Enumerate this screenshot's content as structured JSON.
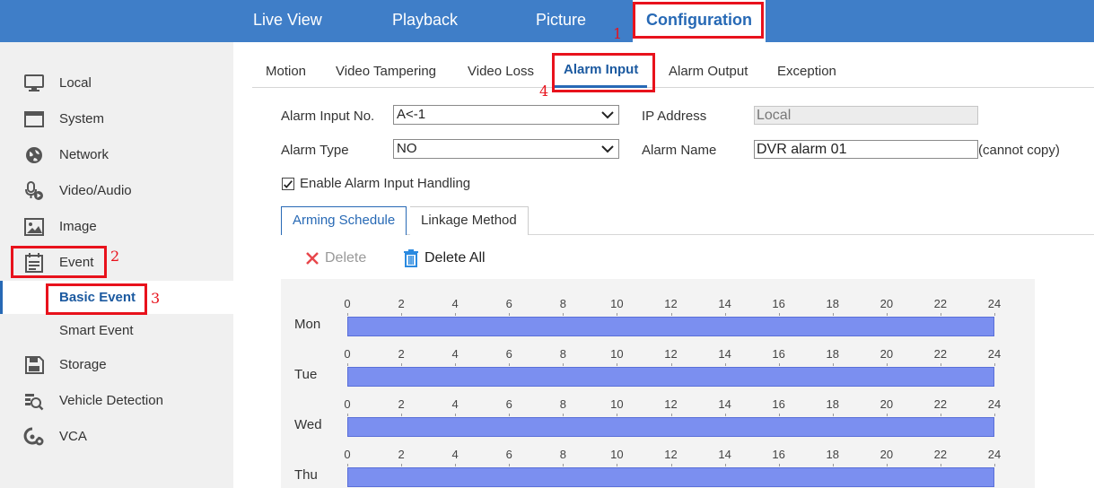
{
  "topnav": {
    "items": [
      {
        "label": "Live View"
      },
      {
        "label": "Playback"
      },
      {
        "label": "Picture"
      },
      {
        "label": "Configuration"
      }
    ]
  },
  "sidebar": {
    "items": [
      {
        "label": "Local",
        "icon": "monitor-icon"
      },
      {
        "label": "System",
        "icon": "window-icon"
      },
      {
        "label": "Network",
        "icon": "globe-icon"
      },
      {
        "label": "Video/Audio",
        "icon": "microphone-icon"
      },
      {
        "label": "Image",
        "icon": "image-icon"
      },
      {
        "label": "Event",
        "icon": "calendar-icon"
      },
      {
        "label": "Storage",
        "icon": "floppy-disk-icon"
      },
      {
        "label": "Vehicle Detection",
        "icon": "vehicle-search-icon"
      },
      {
        "label": "VCA",
        "icon": "vca-icon"
      }
    ],
    "event_sub": [
      {
        "label": "Basic Event"
      },
      {
        "label": "Smart Event"
      }
    ]
  },
  "subtabs": [
    {
      "label": "Motion"
    },
    {
      "label": "Video Tampering"
    },
    {
      "label": "Video Loss"
    },
    {
      "label": "Alarm Input"
    },
    {
      "label": "Alarm Output"
    },
    {
      "label": "Exception"
    }
  ],
  "form": {
    "alarm_input_no_label": "Alarm Input No.",
    "alarm_input_no_value": "A<-1",
    "alarm_type_label": "Alarm Type",
    "alarm_type_value": "NO",
    "ip_address_label": "IP Address",
    "ip_address_value": "Local",
    "alarm_name_label": "Alarm Name",
    "alarm_name_value": "DVR alarm 01",
    "alarm_name_note": "(cannot copy)",
    "enable_label": "Enable Alarm Input Handling",
    "enable_checked": true
  },
  "schedule": {
    "tabs": [
      {
        "label": "Arming Schedule"
      },
      {
        "label": "Linkage Method"
      }
    ],
    "delete_label": "Delete",
    "delete_all_label": "Delete All",
    "ticks": [
      "0",
      "2",
      "4",
      "6",
      "8",
      "10",
      "12",
      "14",
      "16",
      "18",
      "20",
      "22",
      "24"
    ],
    "days": [
      {
        "label": "Mon",
        "armed_hours": [
          0,
          24
        ]
      },
      {
        "label": "Tue",
        "armed_hours": [
          0,
          24
        ]
      },
      {
        "label": "Wed",
        "armed_hours": [
          0,
          24
        ]
      },
      {
        "label": "Thu",
        "armed_hours": [
          0,
          24
        ]
      }
    ]
  },
  "annotations": [
    "1",
    "2",
    "3",
    "4"
  ],
  "colors": {
    "nav_bg": "#3f7ec8",
    "accent": "#2769b5",
    "schedule_bar": "#7b8ff0",
    "annotation_red": "#e8121c"
  }
}
